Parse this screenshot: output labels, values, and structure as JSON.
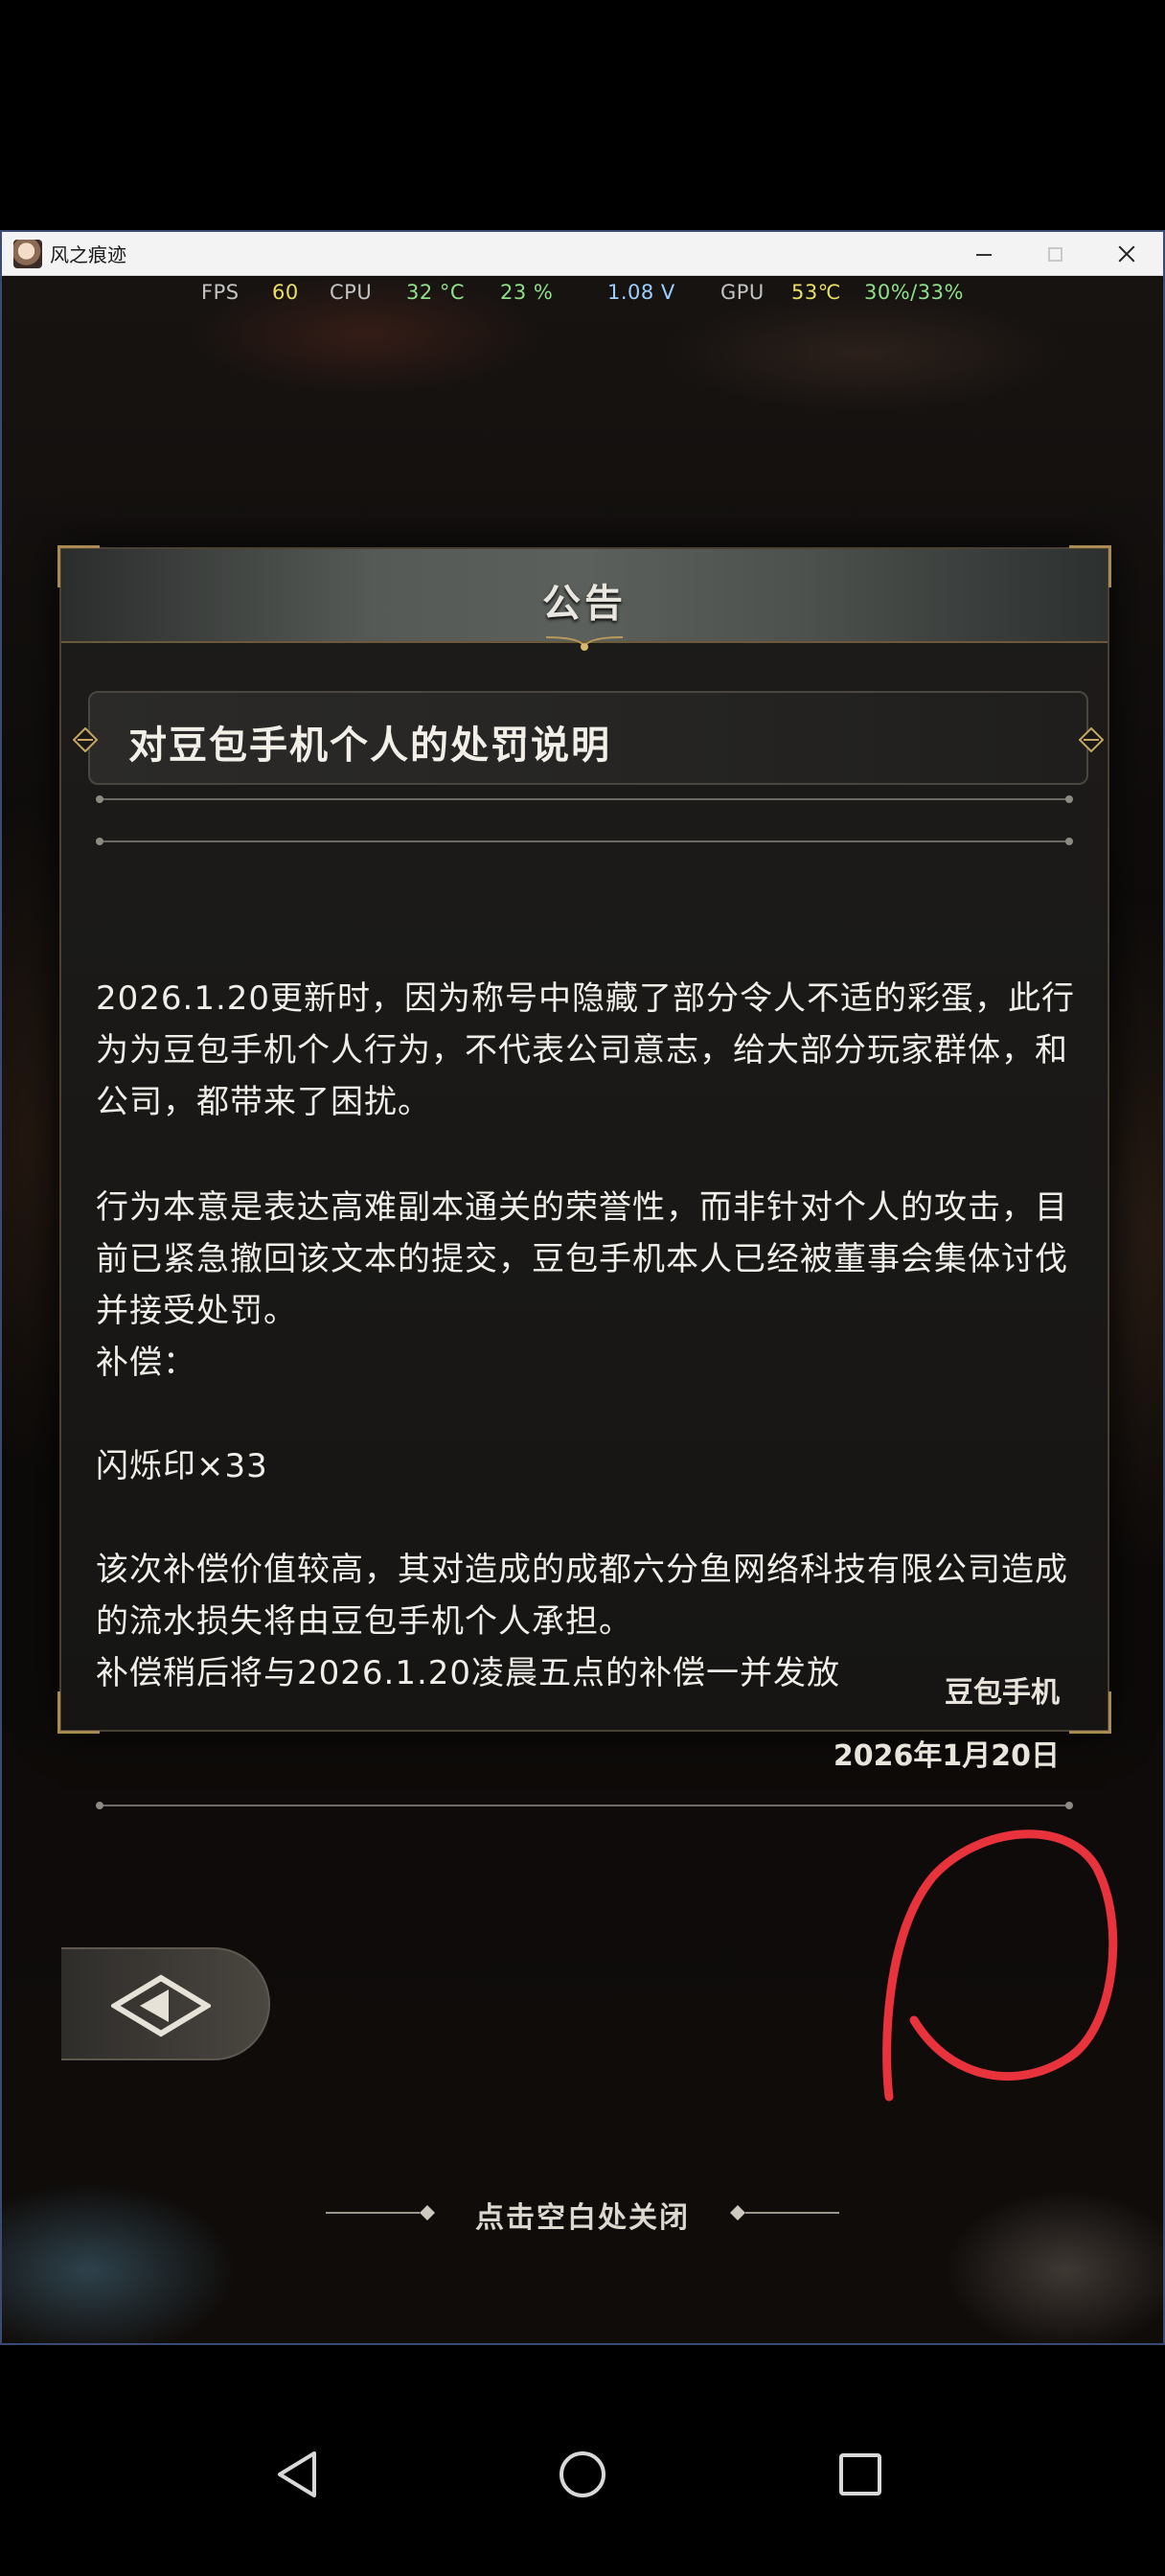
{
  "window": {
    "title": "风之痕迹",
    "controls": {
      "minimize": "minimize",
      "maximize": "maximize",
      "close": "close"
    }
  },
  "stats": {
    "fps_label": "FPS",
    "fps": "60",
    "cpu_label": "CPU",
    "cpu_temp": "32 °C",
    "cpu_load": "23 %",
    "voltage": "1.08 V",
    "gpu_label": "GPU",
    "gpu_temp": "53℃",
    "gpu_load": "30%/33%"
  },
  "panel": {
    "header": "公告",
    "subject": "对豆包手机个人的处罚说明",
    "paragraphs": [
      "2026.1.20更新时，因为称号中隐藏了部分令人不适的彩蛋，此行为为豆包手机个人行为，不代表公司意志，给大部分玩家群体，和公司，都带来了困扰。",
      "行为本意是表达高难副本通关的荣誉性，而非针对个人的攻击，目前已紧急撤回该文本的提交，豆包手机本人已经被董事会集体讨伐并接受处罚。",
      "补偿：",
      "闪烁印×33",
      "该次补偿价值较高，其对造成的成都六分鱼网络科技有限公司造成的流水损失将由豆包手机个人承担。",
      "补偿稍后将与2026.1.20凌晨五点的补偿一并发放"
    ],
    "signature": "豆包手机",
    "date": "2026年1月20日"
  },
  "close_hint": "点击空白处关闭",
  "icons": {
    "back": "back-arrow-icon",
    "nav_back": "triangle-back-icon",
    "nav_home": "circle-home-icon",
    "nav_recent": "square-recent-icon"
  },
  "colors": {
    "panel_bg": "#1a1917",
    "header_bg": "#565a57",
    "accent_gold": "#a88a52",
    "text": "#f0eee9",
    "marker_red": "#e8323c"
  }
}
